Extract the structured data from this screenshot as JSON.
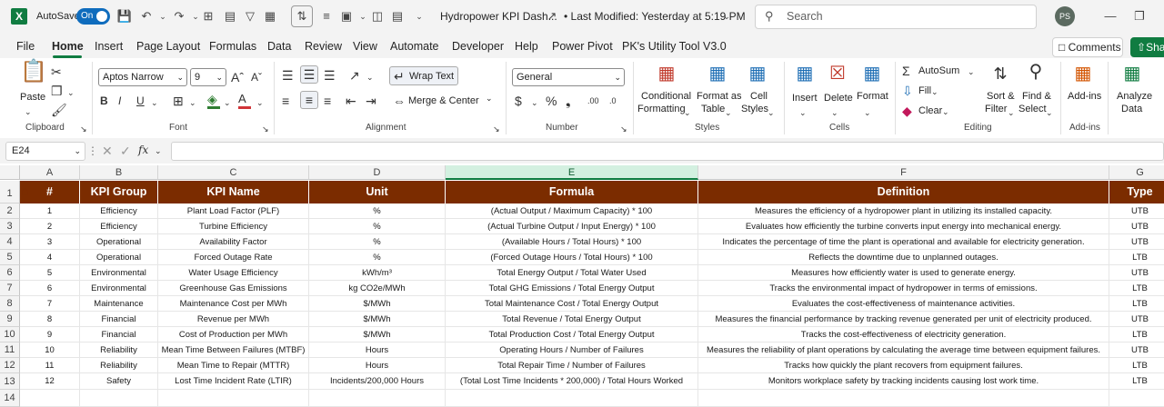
{
  "titlebar": {
    "app_logo": "X",
    "autosave_label": "AutoSave",
    "autosave_state": "On",
    "doc_title": "Hydropower KPI Dash...",
    "last_modified": "• Last Modified: Yesterday at 5:19 PM",
    "search_placeholder": "Search",
    "user_initials": "PS"
  },
  "tabs": [
    "File",
    "Home",
    "Insert",
    "Page Layout",
    "Formulas",
    "Data",
    "Review",
    "View",
    "Automate",
    "Developer",
    "Help",
    "Power Pivot",
    "PK's Utility Tool V3.0"
  ],
  "active_tab": "Home",
  "top_buttons": {
    "comments": "Comments",
    "share": "Sha"
  },
  "ribbon": {
    "clipboard": {
      "paste": "Paste",
      "group": "Clipboard"
    },
    "font": {
      "family": "Aptos Narrow",
      "size": "9",
      "bold": "B",
      "italic": "I",
      "underline": "U",
      "group": "Font"
    },
    "alignment": {
      "wrap_text": "Wrap Text",
      "merge_center": "Merge & Center",
      "group": "Alignment"
    },
    "number": {
      "format": "General",
      "group": "Number"
    },
    "styles": {
      "conditional": "Conditional",
      "formatting": "Formatting",
      "format_as": "Format as",
      "table": "Table",
      "cell": "Cell",
      "styles_btn": "Styles",
      "group": "Styles"
    },
    "cells": {
      "insert": "Insert",
      "delete": "Delete",
      "format": "Format",
      "group": "Cells"
    },
    "editing": {
      "autosum": "AutoSum",
      "fill": "Fill",
      "clear": "Clear",
      "sort": "Sort &",
      "filter": "Filter",
      "find": "Find &",
      "select": "Select",
      "group": "Editing"
    },
    "addins": {
      "addins": "Add-ins",
      "group": "Add-ins"
    },
    "analyze": {
      "line1": "Analyze",
      "line2": "Data"
    }
  },
  "formula_bar": {
    "name_box": "E24",
    "fx": "fx",
    "formula": ""
  },
  "columns": [
    "A",
    "B",
    "C",
    "D",
    "E",
    "F",
    "G"
  ],
  "row_numbers": [
    "1",
    "2",
    "3",
    "4",
    "5",
    "6",
    "7",
    "8",
    "9",
    "10",
    "11",
    "12",
    "13",
    "14"
  ],
  "table": {
    "headers": [
      "#",
      "KPI Group",
      "KPI Name",
      "Unit",
      "Formula",
      "Definition",
      "Type"
    ],
    "rows": [
      [
        "1",
        "Efficiency",
        "Plant Load Factor (PLF)",
        "%",
        "(Actual Output / Maximum Capacity) * 100",
        "Measures the efficiency of a hydropower plant in utilizing its installed capacity.",
        "UTB"
      ],
      [
        "2",
        "Efficiency",
        "Turbine Efficiency",
        "%",
        "(Actual Turbine Output / Input Energy) * 100",
        "Evaluates how efficiently the turbine converts input energy into mechanical energy.",
        "UTB"
      ],
      [
        "3",
        "Operational",
        "Availability Factor",
        "%",
        "(Available Hours / Total Hours) * 100",
        "Indicates the percentage of time the plant is operational and available for electricity generation.",
        "UTB"
      ],
      [
        "4",
        "Operational",
        "Forced Outage Rate",
        "%",
        "(Forced Outage Hours / Total Hours) * 100",
        "Reflects the downtime due to unplanned outages.",
        "LTB"
      ],
      [
        "5",
        "Environmental",
        "Water Usage Efficiency",
        "kWh/m³",
        "Total Energy Output / Total Water Used",
        "Measures how efficiently water is used to generate energy.",
        "UTB"
      ],
      [
        "6",
        "Environmental",
        "Greenhouse Gas Emissions",
        "kg CO2e/MWh",
        "Total GHG Emissions / Total Energy Output",
        "Tracks the environmental impact of hydropower in terms of emissions.",
        "LTB"
      ],
      [
        "7",
        "Maintenance",
        "Maintenance Cost per MWh",
        "$/MWh",
        "Total Maintenance Cost / Total Energy Output",
        "Evaluates the cost-effectiveness of maintenance activities.",
        "LTB"
      ],
      [
        "8",
        "Financial",
        "Revenue per MWh",
        "$/MWh",
        "Total Revenue / Total Energy Output",
        "Measures the financial performance by tracking revenue generated per unit of electricity produced.",
        "UTB"
      ],
      [
        "9",
        "Financial",
        "Cost of Production per MWh",
        "$/MWh",
        "Total Production Cost / Total Energy Output",
        "Tracks the cost-effectiveness of electricity generation.",
        "LTB"
      ],
      [
        "10",
        "Reliability",
        "Mean Time Between Failures (MTBF)",
        "Hours",
        "Operating Hours / Number of Failures",
        "Measures the reliability of plant operations by calculating the average time between equipment failures.",
        "UTB"
      ],
      [
        "11",
        "Reliability",
        "Mean Time to Repair (MTTR)",
        "Hours",
        "Total Repair Time / Number of Failures",
        "Tracks how quickly the plant recovers from equipment failures.",
        "LTB"
      ],
      [
        "12",
        "Safety",
        "Lost Time Incident Rate (LTIR)",
        "Incidents/200,000 Hours",
        "(Total Lost Time Incidents * 200,000) / Total Hours Worked",
        "Monitors workplace safety by tracking incidents causing lost work time.",
        "LTB"
      ]
    ]
  },
  "colors": {
    "header_bg": "#7b2c00",
    "accent": "#107c41",
    "toggle": "#0f6cbd"
  }
}
